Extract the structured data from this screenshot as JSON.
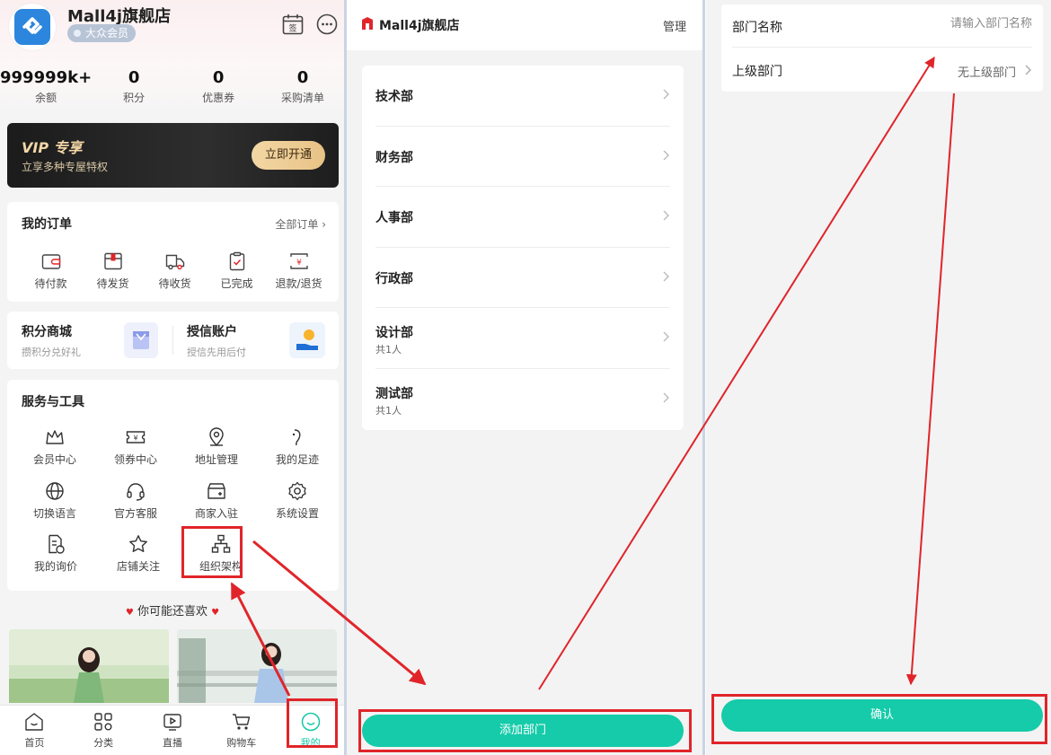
{
  "profile": {
    "shop_name": "Mall4j旗舰店",
    "member_level": "大众会员",
    "checkin_icon_text": "签"
  },
  "stats": [
    {
      "value": "999999k+",
      "label": "余额"
    },
    {
      "value": "0",
      "label": "积分"
    },
    {
      "value": "0",
      "label": "优惠券"
    },
    {
      "value": "0",
      "label": "采购清单"
    }
  ],
  "vip": {
    "title": "VIP 专享",
    "subtitle": "立享多种专屋特权",
    "button": "立即开通"
  },
  "orders": {
    "title": "我的订单",
    "more": "全部订单 ›",
    "items": [
      "待付款",
      "待发货",
      "待收货",
      "已完成",
      "退款/退货"
    ]
  },
  "points_mall": {
    "title": "积分商城",
    "subtitle": "攒积分兑好礼"
  },
  "credit": {
    "title": "授信账户",
    "subtitle": "授信先用后付"
  },
  "services": {
    "title": "服务与工具",
    "items": [
      "会员中心",
      "领券中心",
      "地址管理",
      "我的足迹",
      "切换语言",
      "官方客服",
      "商家入驻",
      "系统设置",
      "我的询价",
      "店铺关注",
      "组织架构"
    ]
  },
  "recommend": {
    "title": "你可能还喜欢"
  },
  "tabbar": {
    "items": [
      "首页",
      "分类",
      "直播",
      "购物车",
      "我的"
    ],
    "active": "我的"
  },
  "departments_page": {
    "store_name": "Mall4j旗舰店",
    "manage": "管理",
    "departments": [
      {
        "name": "技术部",
        "count": ""
      },
      {
        "name": "财务部",
        "count": ""
      },
      {
        "name": "人事部",
        "count": ""
      },
      {
        "name": "行政部",
        "count": ""
      },
      {
        "name": "设计部",
        "count": "共1人"
      },
      {
        "name": "测试部",
        "count": "共1人"
      }
    ],
    "add_button": "添加部门"
  },
  "add_form": {
    "name_label": "部门名称",
    "name_placeholder": "请输入部门名称",
    "parent_label": "上级部门",
    "parent_value": "无上级部门",
    "confirm": "确认"
  },
  "colors": {
    "accent": "#15cba9",
    "annotation_red": "#e0252a",
    "vip_gold": "#f2d7a7"
  }
}
